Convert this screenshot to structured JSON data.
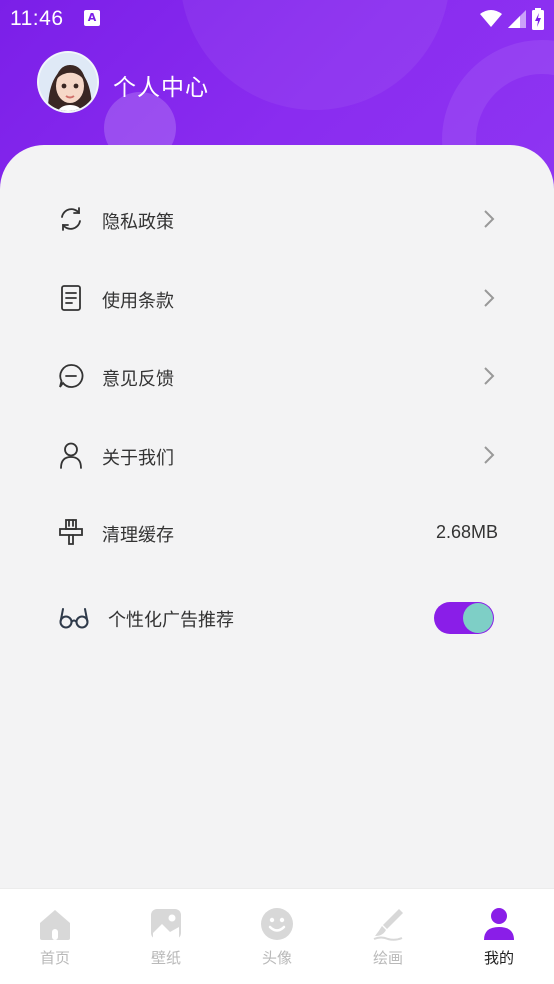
{
  "status_bar": {
    "time": "11:46",
    "notification_letter": "A"
  },
  "header": {
    "title": "个人中心"
  },
  "menu": {
    "items": [
      {
        "label": "隐私政策",
        "icon": "refresh-icon"
      },
      {
        "label": "使用条款",
        "icon": "document-icon"
      },
      {
        "label": "意见反馈",
        "icon": "chat-icon"
      },
      {
        "label": "关于我们",
        "icon": "person-icon"
      }
    ],
    "cache": {
      "label": "清理缓存",
      "value": "2.68MB",
      "icon": "brush-icon"
    },
    "ads": {
      "label": "个性化广告推荐",
      "icon": "glasses-icon",
      "enabled": true
    }
  },
  "bottom_nav": {
    "items": [
      {
        "label": "首页",
        "icon": "home-icon"
      },
      {
        "label": "壁纸",
        "icon": "image-icon"
      },
      {
        "label": "头像",
        "icon": "smile-icon"
      },
      {
        "label": "绘画",
        "icon": "brush-pen-icon"
      },
      {
        "label": "我的",
        "icon": "profile-icon",
        "active": true
      }
    ]
  },
  "colors": {
    "accent": "#8a1ee8",
    "toggle_knob": "#7ecfc6",
    "header": "#7b1fe8"
  }
}
